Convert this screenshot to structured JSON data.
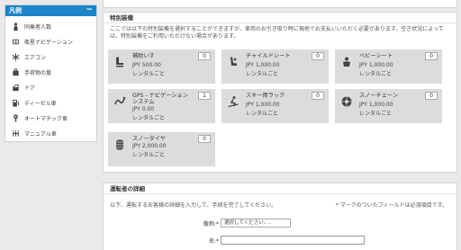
{
  "legend": {
    "title": "凡例",
    "toggle": "−",
    "items": [
      {
        "label": "同乗者人数",
        "icon": "person-icon"
      },
      {
        "label": "衛星ナビゲーション",
        "icon": "navigation-icon"
      },
      {
        "label": "エアコン",
        "icon": "snowflake-icon"
      },
      {
        "label": "手荷物の量",
        "icon": "luggage-icon"
      },
      {
        "label": "ドア",
        "icon": "car-door-icon"
      },
      {
        "label": "ディーゼル車",
        "icon": "fuel-pump-icon"
      },
      {
        "label": "オートマチック車",
        "icon": "automatic-gear-icon"
      },
      {
        "label": "マニュアル車",
        "icon": "manual-gear-icon"
      }
    ]
  },
  "equipment": {
    "title": "特別装備",
    "description": "ここでは以下の特別装備を選択することができますが、車両のお引き取り時に現地でお支払いいただく必要があります。空き状況によっては、特別装備をご利用いただけない場合があります。",
    "items": [
      {
        "name": "補助いす",
        "price": "JPY 500.00",
        "unit": "レンタルごと",
        "qty": "0",
        "icon": "booster-seat-icon"
      },
      {
        "name": "チャイルドシート",
        "price": "JPY 1,000.00",
        "unit": "レンタルごと",
        "qty": "0",
        "icon": "child-seat-icon"
      },
      {
        "name": "ベビーシート",
        "price": "JPY 1,000.00",
        "unit": "レンタルごと",
        "qty": "0",
        "icon": "baby-seat-icon"
      },
      {
        "name": "GPS - ナビゲーションシステム",
        "price": "JPY 0.00",
        "unit": "レンタルごと",
        "qty": "1",
        "icon": "gps-icon"
      },
      {
        "name": "スキー用ラック",
        "price": "JPY 1,000.00",
        "unit": "レンタルごと",
        "qty": "0",
        "icon": "ski-rack-icon"
      },
      {
        "name": "スノーチェーン",
        "price": "JPY 1,000.00",
        "unit": "レンタルごと",
        "qty": "0",
        "icon": "snow-chain-icon"
      },
      {
        "name": "スノータイヤ",
        "price": "JPY 2,000.00",
        "unit": "レンタルごと",
        "qty": "0",
        "icon": "snow-tire-icon"
      }
    ]
  },
  "driver": {
    "title": "運転者の詳細",
    "instructions": "以下、運転するお客様の詳細を入力して、手続を完了してください。",
    "required_note": "* マークのついたフィールドは必須項目です。",
    "honorific_label": "敬称:*",
    "honorific_placeholder": "選択してください。..",
    "name_label": "名:*",
    "name_value": ""
  }
}
